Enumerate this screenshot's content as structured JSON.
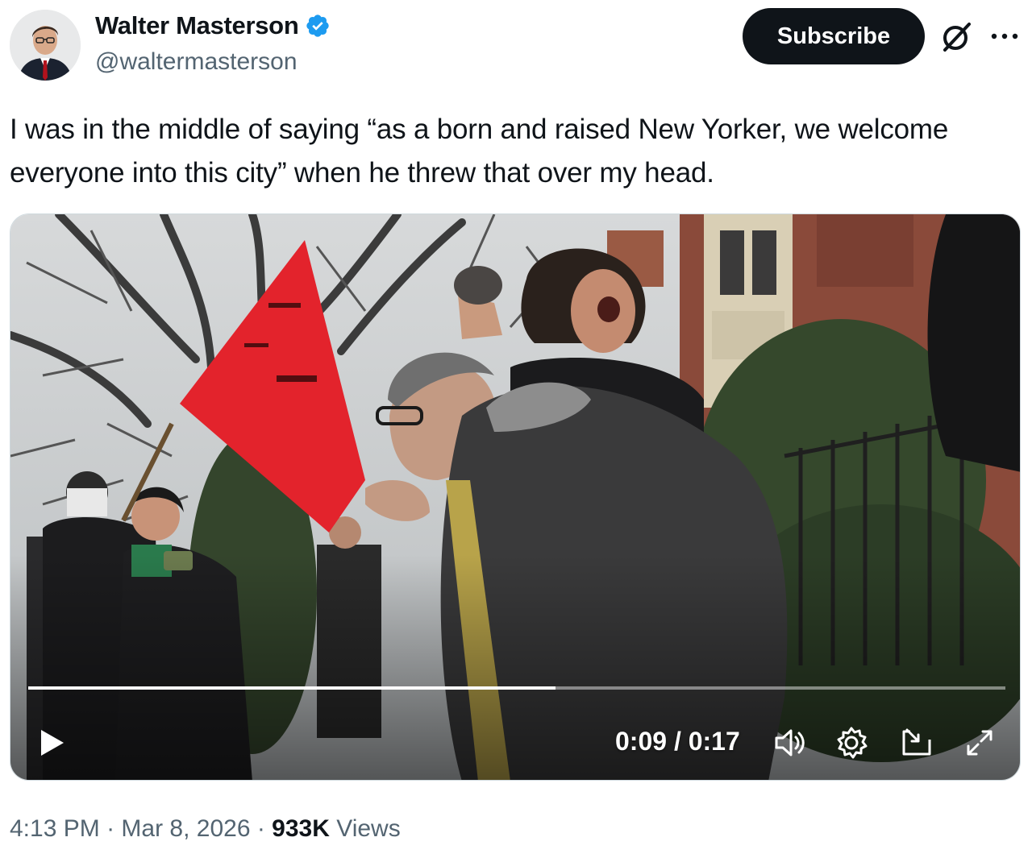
{
  "author": {
    "display_name": "Walter Masterson",
    "handle": "@waltermasterson",
    "verified": true,
    "verified_color": "#1d9bf0"
  },
  "actions": {
    "subscribe_label": "Subscribe",
    "grok_icon": "grok-icon",
    "more_icon": "more-icon"
  },
  "tweet": {
    "text": "I was in the middle of saying “as a born and raised New Yorker, we welcome everyone into this city” when he threw that over my head."
  },
  "video": {
    "current_time": "0:09",
    "separator": " / ",
    "duration": "0:17",
    "progress_fraction": 0.54,
    "icons": [
      "play-icon",
      "volume-icon",
      "settings-icon",
      "picture-in-picture-icon",
      "fullscreen-icon"
    ]
  },
  "meta": {
    "time": "4:13 PM",
    "dot": " · ",
    "date": "Mar 8, 2026",
    "views_count": "933K",
    "views_label": " Views"
  },
  "colors": {
    "button_bg": "#0f1419",
    "muted_text": "#536471",
    "flag_red": "#e3232c"
  }
}
